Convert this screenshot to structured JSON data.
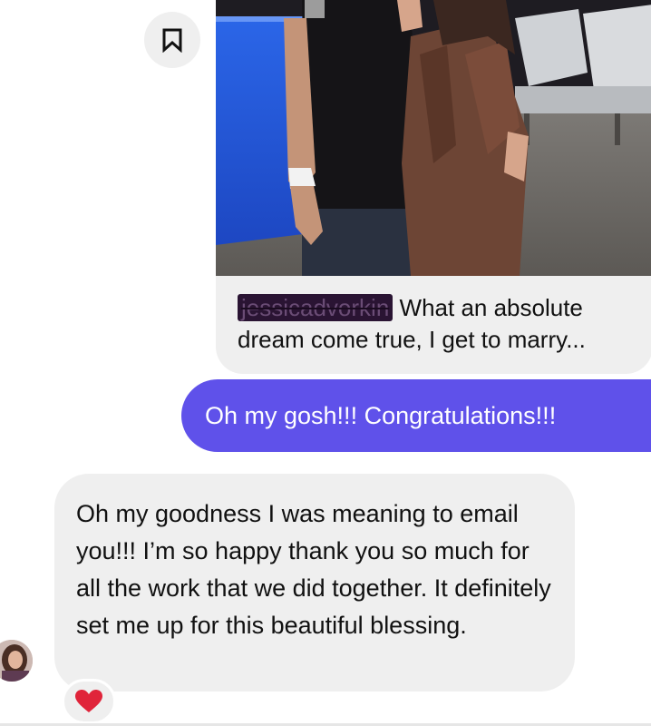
{
  "icons": {
    "save": "bookmark-icon",
    "reaction": "red-heart-icon"
  },
  "shared_post": {
    "username": "jessicadvorkin",
    "caption": "What an absolute dream come true, I get to marry..."
  },
  "messages": {
    "sent": "Oh my gosh!!! Congratulations!!!",
    "received": "Oh my goodness I was meaning to email you!!! I’m so happy thank you so much for all the work that we did together. It definitely set me up for this beautiful blessing."
  },
  "colors": {
    "sent_bubble": "#5f51ea",
    "received_bubble": "#efefef",
    "heart": "#e0243a"
  }
}
